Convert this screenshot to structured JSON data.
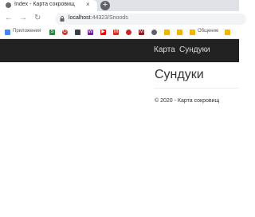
{
  "browser": {
    "tab_title": "Index - Карта сокровищ",
    "tab_close": "×",
    "new_tab": "+",
    "url_host": "localhost",
    "url_path": ":44323/Snoods",
    "nav": {
      "back": "←",
      "forward": "→",
      "reload": "↻"
    }
  },
  "bookmarks": {
    "apps_label": "Приложения",
    "items": [
      {
        "icon": "apps-icon",
        "color": "#4285f4"
      },
      {
        "icon": "s-icon",
        "color": "#1e8e3e",
        "glyph": "S"
      },
      {
        "icon": "g-icon",
        "color": "#d93025",
        "glyph": "G"
      },
      {
        "icon": "doc-icon",
        "color": "#3c4043"
      },
      {
        "icon": "w-icon",
        "color": "#7b1fa2",
        "glyph": "W"
      },
      {
        "icon": "youtube-icon",
        "color": "#ff0000",
        "glyph": "▶"
      },
      {
        "icon": "gmail-icon",
        "color": "#d93025",
        "glyph": "M"
      },
      {
        "icon": "red-icon",
        "color": "#c62828"
      },
      {
        "icon": "mail-icon",
        "color": "#8e1b1b",
        "glyph": "M"
      },
      {
        "icon": "settings-icon",
        "color": "#5f6368"
      },
      {
        "icon": "folder-icon",
        "color": "#f4b400"
      },
      {
        "icon": "folder-icon",
        "color": "#f4b400"
      }
    ],
    "folder_label": "Общение"
  },
  "site": {
    "nav_items": [
      "Карта",
      "Сундуки"
    ],
    "page_title": "Сундуки",
    "footer": "© 2020 - Карта сокровищ"
  }
}
